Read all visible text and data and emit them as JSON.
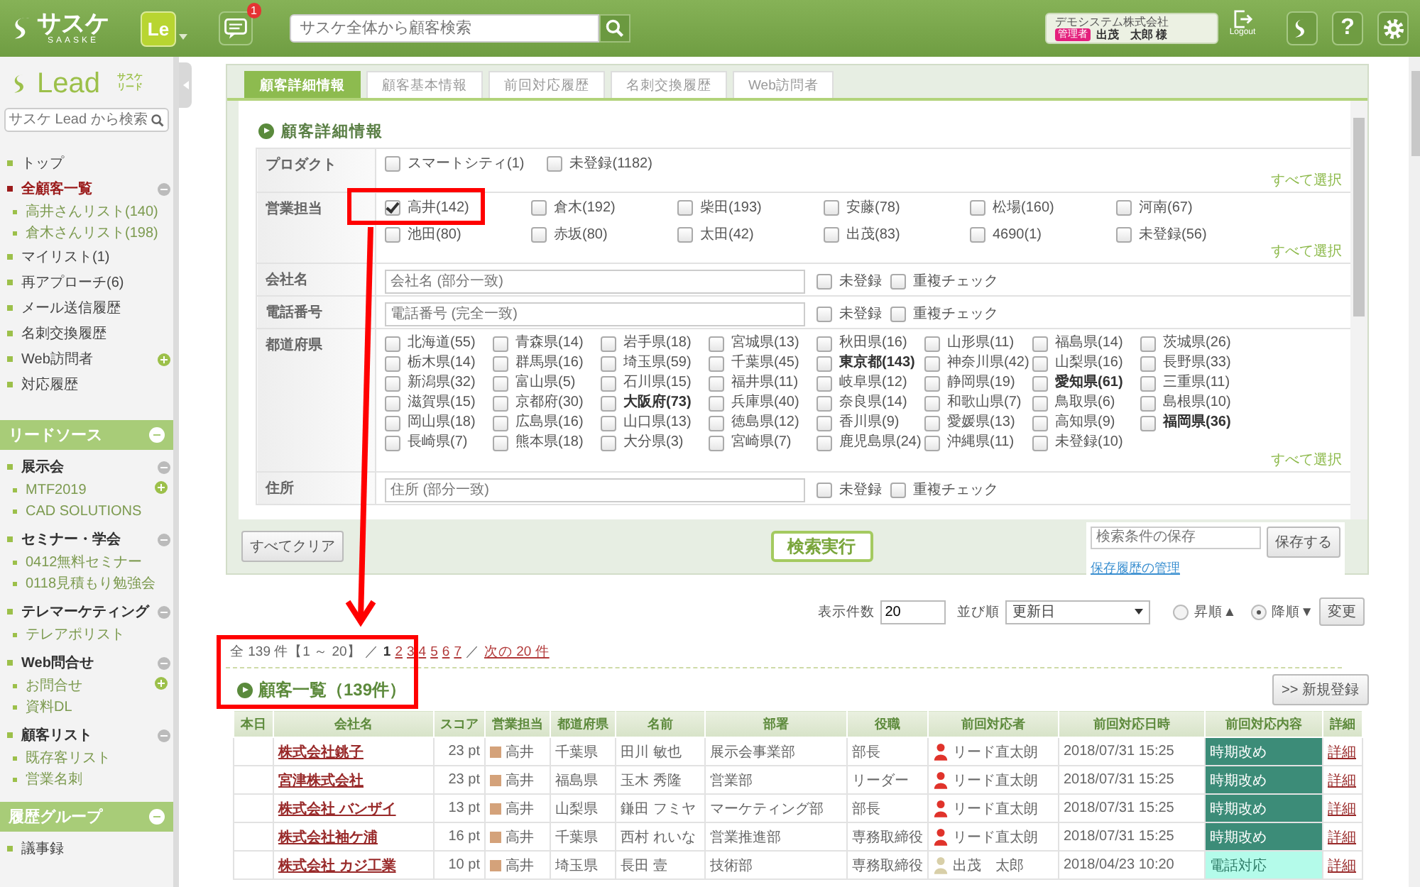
{
  "header": {
    "logo": "サスケ",
    "logo_sub": "SAASKE",
    "app": "Le",
    "notifications": "1",
    "search": {
      "placeholder": "サスケ全体から顧客検索"
    },
    "user": {
      "company": "デモシステム株式会社",
      "role": "管理者",
      "name": "出茂　太郎 様"
    },
    "logout": "Logout",
    "help": "?"
  },
  "sidebar": {
    "logo_text": "Lead",
    "logo_sub": [
      "サスケ",
      "リード"
    ],
    "search": {
      "placeholder": "サスケ Lead から検索"
    },
    "menu": [
      {
        "label": "トップ",
        "selected": false,
        "addable": false
      },
      {
        "label": "全顧客一覧",
        "selected": true,
        "expanded": true,
        "addable": false,
        "children": [
          {
            "label": "高井さんリスト(140)",
            "selected": false,
            "addable": false
          },
          {
            "label": "倉木さんリスト(198)",
            "selected": false,
            "addable": false
          }
        ]
      },
      {
        "label": "マイリスト(1)",
        "selected": false,
        "addable": false
      },
      {
        "label": "再アプローチ(6)",
        "selected": false,
        "addable": false
      },
      {
        "label": "メール送信履歴",
        "selected": false,
        "addable": false
      },
      {
        "label": "名刺交換履歴",
        "selected": false,
        "addable": false
      },
      {
        "label": "Web訪問者",
        "selected": false,
        "addable": true
      },
      {
        "label": "対応履歴",
        "selected": false,
        "addable": false
      }
    ],
    "sections": [
      {
        "title": "リードソース",
        "expanded": true,
        "items": [
          {
            "kind": "group",
            "label": "展示会",
            "expanded": true,
            "children": [
              {
                "label": "MTF2019",
                "selected": false,
                "addable": true
              },
              {
                "label": "CAD SOLUTIONS",
                "selected": false,
                "addable": false
              }
            ]
          },
          {
            "kind": "group",
            "label": "セミナー・学会",
            "expanded": true,
            "children": [
              {
                "label": "0412無料セミナー",
                "selected": false,
                "addable": false
              },
              {
                "label": "0118見積もり勉強会",
                "selected": false,
                "addable": false
              }
            ]
          },
          {
            "kind": "group",
            "label": "テレマーケティング",
            "expanded": true,
            "children": [
              {
                "label": "テレアポリスト",
                "selected": false,
                "addable": false
              }
            ]
          },
          {
            "kind": "group",
            "label": "Web問合せ",
            "expanded": true,
            "children": [
              {
                "label": "お問合せ",
                "selected": false,
                "addable": true
              },
              {
                "label": "資料DL",
                "selected": false,
                "addable": false
              }
            ]
          },
          {
            "kind": "group",
            "label": "顧客リスト",
            "expanded": true,
            "children": [
              {
                "label": "既存客リスト",
                "selected": false,
                "addable": false
              },
              {
                "label": "営業名刺",
                "selected": false,
                "addable": false
              }
            ]
          }
        ]
      },
      {
        "title": "履歴グループ",
        "expanded": true,
        "items": [
          {
            "kind": "item",
            "label": "議事録",
            "selected": false
          }
        ]
      }
    ]
  },
  "search_panel": {
    "tabs": [
      {
        "label": "顧客詳細情報",
        "selected": true
      },
      {
        "label": "顧客基本情報",
        "selected": false
      },
      {
        "label": "前回対応履歴",
        "selected": false
      },
      {
        "label": "名刺交換履歴",
        "selected": false
      },
      {
        "label": "Web訪問者",
        "selected": false
      }
    ],
    "title": "顧客詳細情報",
    "rows": [
      {
        "kind": "checks-inline",
        "label": "プロダクト",
        "select_all": "すべて選択",
        "options": [
          {
            "label": "スマートシティ(1)",
            "checked": false
          },
          {
            "label": "未登録(1182)",
            "checked": false
          }
        ]
      },
      {
        "kind": "checks-wide",
        "label": "営業担当",
        "select_all": "すべて選択",
        "options": [
          {
            "label": "高井(142)",
            "checked": true
          },
          {
            "label": "倉木(192)",
            "checked": false
          },
          {
            "label": "柴田(193)",
            "checked": false
          },
          {
            "label": "安藤(78)",
            "checked": false
          },
          {
            "label": "松場(160)",
            "checked": false
          },
          {
            "label": "河南(67)",
            "checked": false
          },
          {
            "label": "池田(80)",
            "checked": false
          },
          {
            "label": "赤坂(80)",
            "checked": false
          },
          {
            "label": "太田(42)",
            "checked": false
          },
          {
            "label": "出茂(83)",
            "checked": false
          },
          {
            "label": "4690(1)",
            "checked": false
          },
          {
            "label": "未登録(56)",
            "checked": false
          }
        ]
      },
      {
        "kind": "text",
        "label": "会社名",
        "placeholder": "会社名 (部分一致)",
        "checks": [
          {
            "label": "未登録",
            "checked": false
          },
          {
            "label": "重複チェック",
            "checked": false
          }
        ]
      },
      {
        "kind": "text",
        "label": "電話番号",
        "placeholder": "電話番号 (完全一致)",
        "checks": [
          {
            "label": "未登録",
            "checked": false
          },
          {
            "label": "重複チェック",
            "checked": false
          }
        ]
      },
      {
        "kind": "checks-narrow",
        "label": "都道府県",
        "select_all": "すべて選択",
        "options": [
          {
            "label": "北海道(55)",
            "checked": false,
            "bold": false
          },
          {
            "label": "青森県(14)",
            "checked": false,
            "bold": false
          },
          {
            "label": "岩手県(18)",
            "checked": false,
            "bold": false
          },
          {
            "label": "宮城県(13)",
            "checked": false,
            "bold": false
          },
          {
            "label": "秋田県(16)",
            "checked": false,
            "bold": false
          },
          {
            "label": "山形県(11)",
            "checked": false,
            "bold": false
          },
          {
            "label": "福島県(14)",
            "checked": false,
            "bold": false
          },
          {
            "label": "茨城県(26)",
            "checked": false,
            "bold": false
          },
          {
            "label": "栃木県(14)",
            "checked": false,
            "bold": false
          },
          {
            "label": "群馬県(16)",
            "checked": false,
            "bold": false
          },
          {
            "label": "埼玉県(59)",
            "checked": false,
            "bold": false
          },
          {
            "label": "千葉県(45)",
            "checked": false,
            "bold": false
          },
          {
            "label": "東京都(143)",
            "checked": false,
            "bold": true
          },
          {
            "label": "神奈川県(42)",
            "checked": false,
            "bold": false
          },
          {
            "label": "山梨県(16)",
            "checked": false,
            "bold": false
          },
          {
            "label": "長野県(33)",
            "checked": false,
            "bold": false
          },
          {
            "label": "新潟県(32)",
            "checked": false,
            "bold": false
          },
          {
            "label": "富山県(5)",
            "checked": false,
            "bold": false
          },
          {
            "label": "石川県(15)",
            "checked": false,
            "bold": false
          },
          {
            "label": "福井県(11)",
            "checked": false,
            "bold": false
          },
          {
            "label": "岐阜県(12)",
            "checked": false,
            "bold": false
          },
          {
            "label": "静岡県(19)",
            "checked": false,
            "bold": false
          },
          {
            "label": "愛知県(61)",
            "checked": false,
            "bold": true
          },
          {
            "label": "三重県(11)",
            "checked": false,
            "bold": false
          },
          {
            "label": "滋賀県(15)",
            "checked": false,
            "bold": false
          },
          {
            "label": "京都府(30)",
            "checked": false,
            "bold": false
          },
          {
            "label": "大阪府(73)",
            "checked": false,
            "bold": true
          },
          {
            "label": "兵庫県(40)",
            "checked": false,
            "bold": false
          },
          {
            "label": "奈良県(14)",
            "checked": false,
            "bold": false
          },
          {
            "label": "和歌山県(7)",
            "checked": false,
            "bold": false
          },
          {
            "label": "鳥取県(6)",
            "checked": false,
            "bold": false
          },
          {
            "label": "島根県(10)",
            "checked": false,
            "bold": false
          },
          {
            "label": "岡山県(18)",
            "checked": false,
            "bold": false
          },
          {
            "label": "広島県(16)",
            "checked": false,
            "bold": false
          },
          {
            "label": "山口県(13)",
            "checked": false,
            "bold": false
          },
          {
            "label": "徳島県(12)",
            "checked": false,
            "bold": false
          },
          {
            "label": "香川県(9)",
            "checked": false,
            "bold": false
          },
          {
            "label": "愛媛県(13)",
            "checked": false,
            "bold": false
          },
          {
            "label": "高知県(9)",
            "checked": false,
            "bold": false
          },
          {
            "label": "福岡県(36)",
            "checked": false,
            "bold": true
          },
          {
            "label": "長崎県(7)",
            "checked": false,
            "bold": false
          },
          {
            "label": "熊本県(18)",
            "checked": false,
            "bold": false
          },
          {
            "label": "大分県(3)",
            "checked": false,
            "bold": false
          },
          {
            "label": "宮崎県(7)",
            "checked": false,
            "bold": false
          },
          {
            "label": "鹿児島県(24)",
            "checked": false,
            "bold": false
          },
          {
            "label": "沖縄県(11)",
            "checked": false,
            "bold": false
          },
          {
            "label": "未登録(10)",
            "checked": false,
            "bold": false
          }
        ]
      },
      {
        "kind": "text",
        "label": "住所",
        "placeholder": "住所 (部分一致)",
        "checks": [
          {
            "label": "未登録",
            "checked": false
          },
          {
            "label": "重複チェック",
            "checked": false
          }
        ]
      }
    ],
    "clear_button": "すべてクリア",
    "search_button": "検索実行",
    "save": {
      "placeholder": "検索条件の保存",
      "button": "保存する",
      "link": "保存履歴の管理"
    }
  },
  "results": {
    "per_page_label": "表示件数",
    "per_page": "20",
    "sort_label": "並び順",
    "sort": "更新日",
    "order": [
      {
        "label": "昇順▲",
        "selected": false
      },
      {
        "label": "降順▼",
        "selected": true
      }
    ],
    "apply": "変更",
    "pager": {
      "summary": "全 139 件【1 ～ 20】 ／",
      "pages": [
        {
          "label": "1",
          "selected": true
        },
        {
          "label": "2",
          "selected": false
        },
        {
          "label": "3",
          "selected": false
        },
        {
          "label": "4",
          "selected": false
        },
        {
          "label": "5",
          "selected": false
        },
        {
          "label": "6",
          "selected": false
        },
        {
          "label": "7",
          "selected": false
        }
      ],
      "sep": "／",
      "next": "次の 20 件"
    },
    "title": "顧客一覧（139件）",
    "new_button": ">> 新規登録",
    "columns": [
      "本日",
      "会社名",
      "スコア",
      "営業担当",
      "都道府県",
      "名前",
      "部署",
      "役職",
      "前回対応者",
      "前回対応日時",
      "前回対応内容",
      "詳細"
    ],
    "rows": [
      {
        "company": "株式会社銚子",
        "score": "23 pt",
        "rep": {
          "name": "高井",
          "color": "#d4a27a"
        },
        "prefecture": "千葉県",
        "name": "田川 敏也",
        "department": "展示会事業部",
        "title": "部長",
        "contact": {
          "name": "リード直太朗",
          "color": "#e0332b"
        },
        "datetime": "2018/07/31 15:25",
        "content": {
          "text": "時期改め",
          "color": "#3c8c78"
        },
        "detail": "詳細"
      },
      {
        "company": "宮津株式会社",
        "score": "23 pt",
        "rep": {
          "name": "高井",
          "color": "#d4a27a"
        },
        "prefecture": "福島県",
        "name": "玉木 秀隆",
        "department": "営業部",
        "title": "リーダー",
        "contact": {
          "name": "リード直太朗",
          "color": "#e0332b"
        },
        "datetime": "2018/07/31 15:25",
        "content": {
          "text": "時期改め",
          "color": "#3c8c78"
        },
        "detail": "詳細"
      },
      {
        "company": "株式会社 バンザイ",
        "score": "13 pt",
        "rep": {
          "name": "高井",
          "color": "#d4a27a"
        },
        "prefecture": "山梨県",
        "name": "鎌田 フミヤ",
        "department": "マーケティング部",
        "title": "部長",
        "contact": {
          "name": "リード直太朗",
          "color": "#e0332b"
        },
        "datetime": "2018/07/31 15:25",
        "content": {
          "text": "時期改め",
          "color": "#3c8c78"
        },
        "detail": "詳細"
      },
      {
        "company": "株式会社袖ケ浦",
        "score": "16 pt",
        "rep": {
          "name": "高井",
          "color": "#d4a27a"
        },
        "prefecture": "千葉県",
        "name": "西村 れいな",
        "department": "営業推進部",
        "title": "専務取締役",
        "contact": {
          "name": "リード直太朗",
          "color": "#e0332b"
        },
        "datetime": "2018/07/31 15:25",
        "content": {
          "text": "時期改め",
          "color": "#3c8c78"
        },
        "detail": "詳細"
      },
      {
        "company": "株式会社 カジ工業",
        "score": "10 pt",
        "rep": {
          "name": "高井",
          "color": "#d4a27a"
        },
        "prefecture": "埼玉県",
        "name": "長田 壹",
        "department": "技術部",
        "title": "専務取締役",
        "contact": {
          "name": "出茂　太郎",
          "color": "#d8cfa8"
        },
        "datetime": "2018/04/23 10:20",
        "content": {
          "text": "電話対応",
          "color": "#b4fbea"
        },
        "detail": "詳細"
      }
    ]
  }
}
